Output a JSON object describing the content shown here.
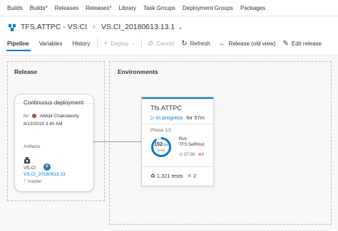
{
  "topnav": {
    "items": [
      "Builds",
      "Builds*",
      "Releases",
      "Releases*",
      "Library",
      "Task Groups",
      "Deployment Groups",
      "Packages"
    ]
  },
  "header": {
    "pipeline_title": "TFS.ATTPC - VS.CI",
    "separator": "›",
    "release_name": "VS.CI_20180613.13.1",
    "chevron": "⌄"
  },
  "tabs": [
    "Pipeline",
    "Variables",
    "History"
  ],
  "toolbar": {
    "deploy": "Deploy",
    "cancel": "Cancel",
    "refresh": "Refresh",
    "release_old_view": "Release (old view)",
    "edit_release": "Edit release"
  },
  "release_panel": {
    "label": "Release",
    "card_title": "Continuous deployment",
    "for_label": "for",
    "author": "Abhijit Chakraborty",
    "timestamp": "6/13/2018 3:40 AM",
    "artifacts_label": "Artifacts",
    "artifact_name": "VS.CI",
    "artifact_version": "VS.CI_20180613.13",
    "branch": "master"
  },
  "environments_panel": {
    "label": "Environments",
    "env_name": "Tfs.ATTPC",
    "status": "In progress",
    "status_time": "for 57m",
    "phase": "Phase 1/2",
    "progress_done": 152,
    "progress_total": "/168",
    "progress_unit": "tasks",
    "run_label": "Run",
    "run_target": "TFS.SelfHost",
    "run_time": "37:36",
    "run_errors": "4",
    "tests": "1,321 tests",
    "test_failures": "2"
  },
  "colors": {
    "accent": "#0078d4",
    "error": "#d13438"
  }
}
